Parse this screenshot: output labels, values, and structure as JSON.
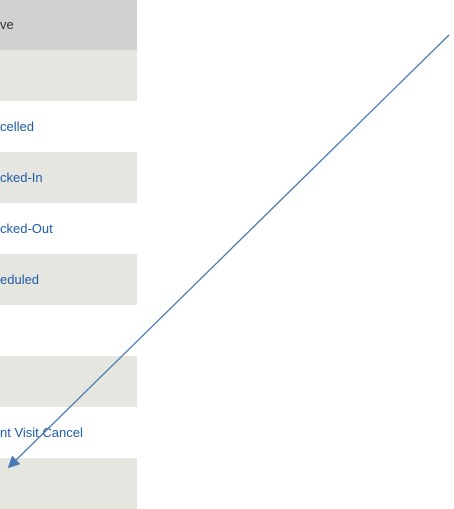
{
  "panel": {
    "header_label": "ve",
    "rows": [
      {
        "text": "",
        "shaded": true
      },
      {
        "text": "celled",
        "shaded": false
      },
      {
        "text": "cked-In",
        "shaded": true
      },
      {
        "text": "cked-Out",
        "shaded": false
      },
      {
        "text": "eduled",
        "shaded": true
      },
      {
        "text": "",
        "shaded": false
      },
      {
        "text": "",
        "shaded": true
      },
      {
        "text": "nt Visit Cancel",
        "shaded": false
      },
      {
        "text": "",
        "shaded": true
      }
    ]
  },
  "annotation": {
    "arrow_color": "#4a78b0",
    "icon": "arrow-annotation-icon"
  }
}
